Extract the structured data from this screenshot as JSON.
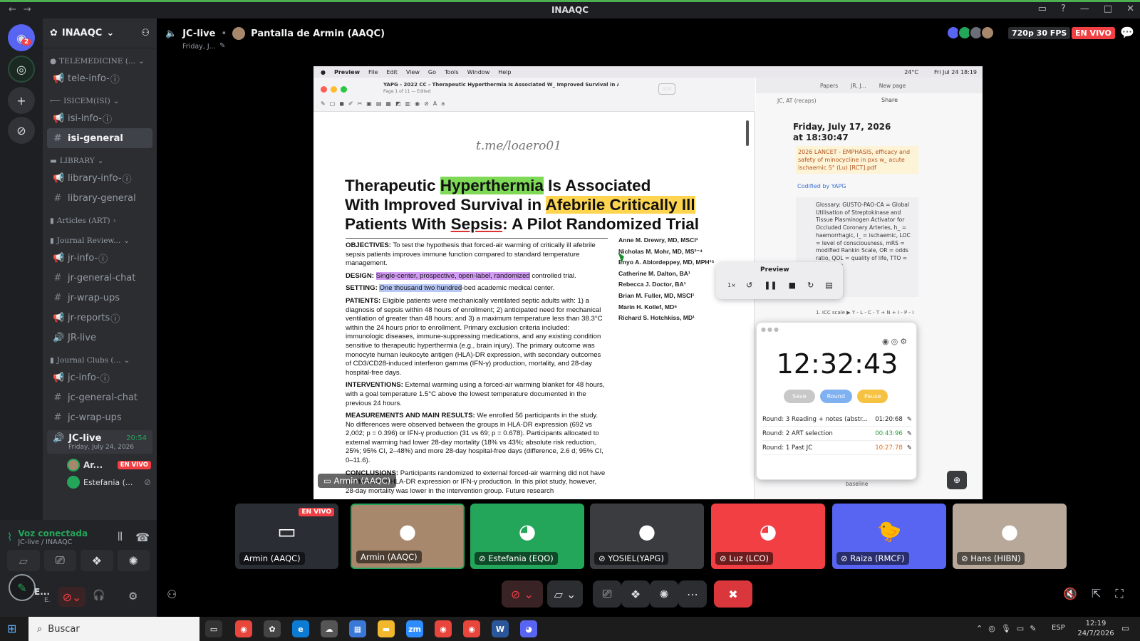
{
  "window": {
    "title": "INAAQC"
  },
  "servers": {
    "home_badge": "2"
  },
  "server": {
    "name": "INAAQC"
  },
  "categories": [
    {
      "label": "TELEMEDICINE (...",
      "channels": [
        {
          "name": "tele-info-",
          "type": "announce"
        }
      ]
    },
    {
      "label": "ISICEM(ISI)",
      "channels": [
        {
          "name": "isi-info-",
          "type": "announce"
        },
        {
          "name": "isi-general",
          "type": "text",
          "bold": true
        }
      ]
    },
    {
      "label": "LIBRARY",
      "channels": [
        {
          "name": "library-info-",
          "type": "announce"
        },
        {
          "name": "library-general",
          "type": "text"
        }
      ]
    },
    {
      "label": "Articles (ART)",
      "channels": []
    },
    {
      "label": "Journal Review...",
      "channels": [
        {
          "name": "jr-info-",
          "type": "announce"
        },
        {
          "name": "jr-general-chat",
          "type": "text"
        },
        {
          "name": "jr-wrap-ups",
          "type": "text"
        },
        {
          "name": "jr-reports",
          "type": "announce"
        },
        {
          "name": "JR-live",
          "type": "voice"
        }
      ]
    },
    {
      "label": "Journal Clubs (...",
      "channels": [
        {
          "name": "jc-info-",
          "type": "announce"
        },
        {
          "name": "jc-general-chat",
          "type": "text"
        },
        {
          "name": "jc-wrap-ups",
          "type": "text"
        }
      ]
    }
  ],
  "live_channel": {
    "name": "JC-live",
    "time": "20:54",
    "date": "Friday, July 24, 2026",
    "members": [
      {
        "name": "Ar...",
        "badge": "EN VIVO"
      },
      {
        "name": "Estefania (..."
      }
    ]
  },
  "voice_status": {
    "title": "Voz conectada",
    "subtitle": "JC-live / INAAQC"
  },
  "user": {
    "short": "E...",
    "sub": "E."
  },
  "header": {
    "channel": "JC-live",
    "screen": "Pantalla de Armin (AAQC)",
    "date": "Friday, J...",
    "quality": "720p 30 FPS",
    "live": "EN VIVO"
  },
  "mac": {
    "menu": [
      "Preview",
      "File",
      "Edit",
      "View",
      "Go",
      "Tools",
      "Window",
      "Help"
    ],
    "status_right": "Fri Jul 24 18:19",
    "temp": "24°C",
    "doc_title": "YAPG - 2022 CC - Therapeutic Hyperthermia Is Associated W_ Improved Survival in Afe...",
    "doc_sub": "Page 1 of 11 — Edited",
    "zoom_value": "924",
    "watermark": "t.me/loaero01"
  },
  "paper": {
    "title_1": "Therapeutic ",
    "title_hl1": "Hyperthermia",
    "title_2": " Is Associated",
    "title_3": "With Improved Survival in ",
    "title_hl2": "Afebrile Critically Ill",
    "title_4": "Patients With ",
    "title_ul": "Sepsis",
    "title_5": ": A Pilot Randomized Trial",
    "objectives_label": "OBJECTIVES:",
    "objectives": "To test the hypothesis that forced-air warming of critically ill afebrile sepsis patients improves immune function compared to standard temperature management.",
    "design_label": "DESIGN:",
    "design_hl": "Single-center, prospective, open-label, randomized",
    "design_rest": " controlled trial.",
    "setting_label": "SETTING:",
    "setting_hl": "One thousand two hundred",
    "setting_rest": "-bed academic medical center.",
    "patients_label": "PATIENTS:",
    "patients": "Eligible patients were mechanically ventilated septic adults with: 1) a diagnosis of sepsis within 48 hours of enrollment; 2) anticipated need for mechanical ventilation of greater than 48 hours; and 3) a maximum temperature less than 38.3°C within the 24 hours prior to enrollment. Primary exclusion criteria included: immunologic diseases, immune-suppressing medications, and any existing condition sensitive to therapeutic hyperthermia (e.g., brain injury). The primary outcome was monocyte human leukocyte antigen (HLA)-DR expression, with secondary outcomes of CD3/CD28-induced interferon gamma (IFN-γ) production, mortality, and 28-day hospital-free days.",
    "interventions_label": "INTERVENTIONS:",
    "interventions": "External warming using a forced-air warming blanket for 48 hours, with a goal temperature 1.5°C above the lowest temperature documented in the previous 24 hours.",
    "results_label": "MEASUREMENTS AND MAIN RESULTS:",
    "results": "We enrolled 56 participants in the study. No differences were observed between the groups in HLA-DR expression (692 vs 2,002; p = 0.396) or IFN-γ production (31 vs 69; p = 0.678). Participants allocated to external warming had lower 28-day mortality (18% vs 43%; absolute risk reduction, 25%; 95% CI, 2–48%) and more 28-day hospital-free days (difference, 2.6 d; 95% CI, 0–11.6).",
    "conclusions_label": "CONCLUSIONS:",
    "conclusions": "Participants randomized to external forced-air warming did not have a difference in HLA-DR expression or IFN-γ production. In this pilot study, however, 28-day mortality was lower in the intervention group. Future research",
    "authors": [
      "Anne M. Drewry, MD, MSCI¹",
      "Nicholas M. Mohr, MD, MS²⁻⁴",
      "Enyo A. Ablordeppey, MD, MPH¹⁵",
      "Catherine M. Dalton, BA¹",
      "Rebecca J. Doctor, BA¹",
      "Brian M. Fuller, MD, MSCI¹",
      "Marin H. Kollef, MD⁶",
      "Richard S. Hotchkiss, MD¹"
    ]
  },
  "notes": {
    "tabs": [
      "Papers",
      "JR, J...",
      "New page"
    ],
    "breadcrumb": "JC, AT (recaps)",
    "share": "Share",
    "heading": "Friday, July 17, 2026 at 18:30:47",
    "callout": "2026 LANCET - EMPHASIS, efficacy and safety of minocycline in pxs w_ acute ischaemic S° (Lu) [RCT].pdf",
    "codified": "Codified by YAPG",
    "glossary": "Glossary: GUSTO-PAO-CA = Global Utilisation of Streptokinase and Tissue Plasminogen Activator for Occluded Coronary Arteries, h_ = haemorrhagic, i_ = ischaemic, LOC = level of consciousness, mRS = modified Rankin Scale, OR = odds ratio, QOL = quality of life, TTO = treatment",
    "list_item": "1. ICC scale ▶ Y - L - C - T + N + I - P - I",
    "footer": "baseline"
  },
  "preview_popup": {
    "title": "Preview",
    "speed": "1×"
  },
  "timer": {
    "time": "12:32:43",
    "buttons": [
      "Save",
      "Round",
      "Pause"
    ],
    "rounds": [
      {
        "label": "Round: 3  Reading + notes (abstr...",
        "time": "01:20:68",
        "color": "#222222"
      },
      {
        "label": "Round: 2  ART selection",
        "time": "00:43:96",
        "color": "#2e9e3e"
      },
      {
        "label": "Round: 1  Past JC",
        "time": "10:27:78",
        "color": "#e0701c"
      }
    ]
  },
  "stream_overlay": {
    "label": "Armin (AAQC)"
  },
  "tiles": [
    {
      "label": "Armin (AAQC)",
      "badge": "EN VIVO",
      "bg": "#2a2d33"
    },
    {
      "label": "Armin (AAQC)",
      "bg": "#a7886d"
    },
    {
      "label": "Estefania (EQO)",
      "bg": "#23a55a"
    },
    {
      "label": "YOSIEL(YAPG)",
      "bg": "#3a3c40"
    },
    {
      "label": "Luz (LCO)",
      "bg": "#f23f43"
    },
    {
      "label": "Raiza (RMCF)",
      "bg": "#5865f2"
    },
    {
      "label": "Hans (HIBN)",
      "bg": "#b7a89a"
    }
  ],
  "taskbar": {
    "search": "Buscar",
    "lang": "ESP",
    "time": "12:19",
    "date": "24/7/2026"
  }
}
